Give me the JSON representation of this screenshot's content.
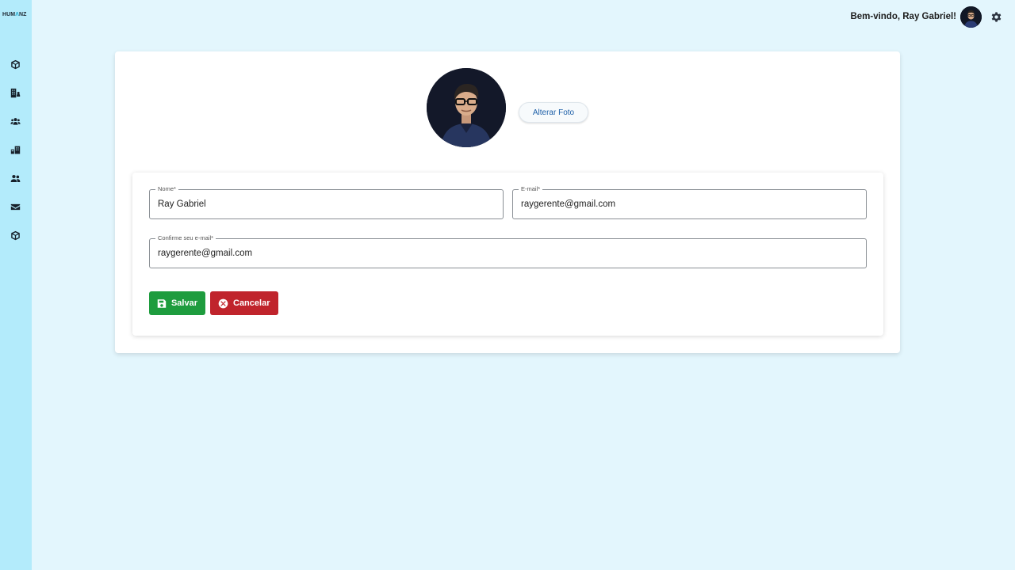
{
  "brand": {
    "logo_pre": "HUM",
    "logo_accent": "Λ",
    "logo_post": "NZ"
  },
  "sidebar": {
    "items": [
      {
        "name": "sidebar-item-products",
        "icon": "box-icon"
      },
      {
        "name": "sidebar-item-companies",
        "icon": "building-user-icon"
      },
      {
        "name": "sidebar-item-teams",
        "icon": "users-icon"
      },
      {
        "name": "sidebar-item-units",
        "icon": "warehouse-icon"
      },
      {
        "name": "sidebar-item-users",
        "icon": "user-group-icon"
      },
      {
        "name": "sidebar-item-messages",
        "icon": "envelope-icon"
      },
      {
        "name": "sidebar-item-packages",
        "icon": "box-icon"
      }
    ]
  },
  "header": {
    "greeting": "Bem-vindo, Ray Gabriel!",
    "avatar_icon": "user-avatar",
    "settings_icon": "gear-icon"
  },
  "profile": {
    "change_photo_label": "Alterar Foto"
  },
  "form": {
    "name": {
      "label": "Nome*",
      "value": "Ray Gabriel"
    },
    "email": {
      "label": "E-mail*",
      "value": "raygerente@gmail.com"
    },
    "confirm_email": {
      "label": "Confirme seu e-mail*",
      "value": "raygerente@gmail.com"
    },
    "save_label": "Salvar",
    "cancel_label": "Cancelar"
  },
  "colors": {
    "background": "#e3f6fd",
    "sidebar": "#b3ebfb",
    "save": "#1e9c3e",
    "cancel": "#c0242c",
    "link": "#1d5fa8"
  }
}
